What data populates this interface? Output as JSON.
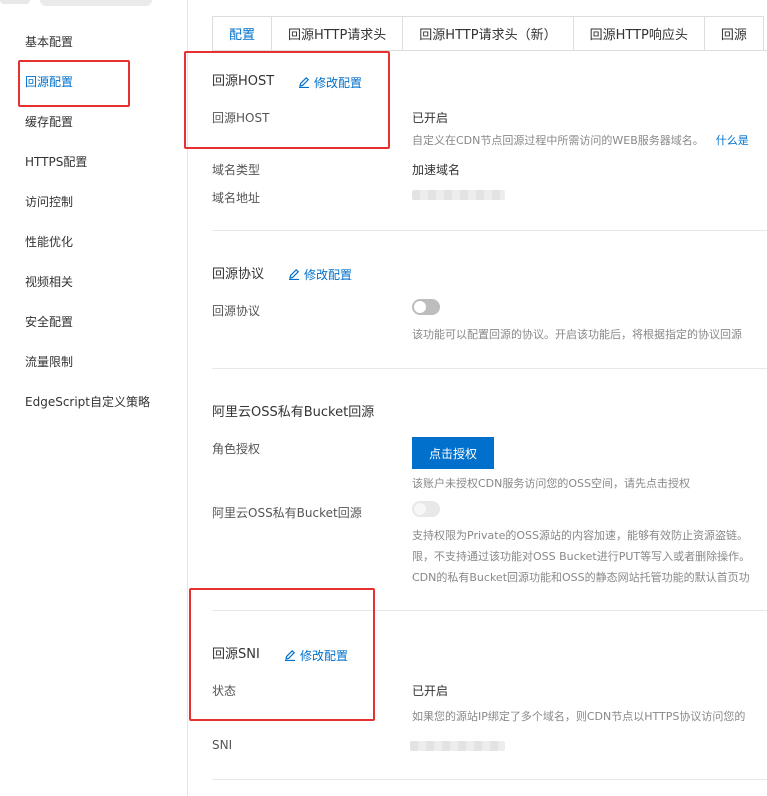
{
  "sidebar": {
    "items": [
      {
        "label": "基本配置"
      },
      {
        "label": "回源配置"
      },
      {
        "label": "缓存配置"
      },
      {
        "label": "HTTPS配置"
      },
      {
        "label": "访问控制"
      },
      {
        "label": "性能优化"
      },
      {
        "label": "视频相关"
      },
      {
        "label": "安全配置"
      },
      {
        "label": "流量限制"
      },
      {
        "label": "EdgeScript自定义策略"
      }
    ],
    "active_index": 1
  },
  "tabs": [
    {
      "label": "配置"
    },
    {
      "label": "回源HTTP请求头"
    },
    {
      "label": "回源HTTP请求头（新）"
    },
    {
      "label": "回源HTTP响应头"
    },
    {
      "label": "回源"
    }
  ],
  "edit_label": "修改配置",
  "origin_host": {
    "title": "回源HOST",
    "row_label": "回源HOST",
    "status": "已开启",
    "hint": "自定义在CDN节点回源过程中所需访问的WEB服务器域名。",
    "hint_link": "什么是",
    "domain_type_label": "域名类型",
    "domain_type_value": "加速域名",
    "domain_address_label": "域名地址"
  },
  "origin_protocol": {
    "title": "回源协议",
    "row_label": "回源协议",
    "hint": "该功能可以配置回源的协议。开启该功能后，将根据指定的协议回源"
  },
  "oss_bucket": {
    "title": "阿里云OSS私有Bucket回源",
    "role_label": "角色授权",
    "authorize_button": "点击授权",
    "role_hint": "该账户未授权CDN服务访问您的OSS空间，请先点击授权",
    "switch_label": "阿里云OSS私有Bucket回源",
    "hint_lines": [
      "支持权限为Private的OSS源站的内容加速，能够有效防止资源盗链。",
      "限，不支持通过该功能对OSS Bucket进行PUT等写入或者删除操作。",
      "CDN的私有Bucket回源功能和OSS的静态网站托管功能的默认首页功"
    ]
  },
  "origin_sni": {
    "title": "回源SNI",
    "status_label": "状态",
    "status_value": "已开启",
    "hint": "如果您的源站IP绑定了多个域名，则CDN节点以HTTPS协议访问您的",
    "sni_label": "SNI"
  },
  "colors": {
    "accent": "#0070cc",
    "highlight_box": "#e5312f"
  }
}
